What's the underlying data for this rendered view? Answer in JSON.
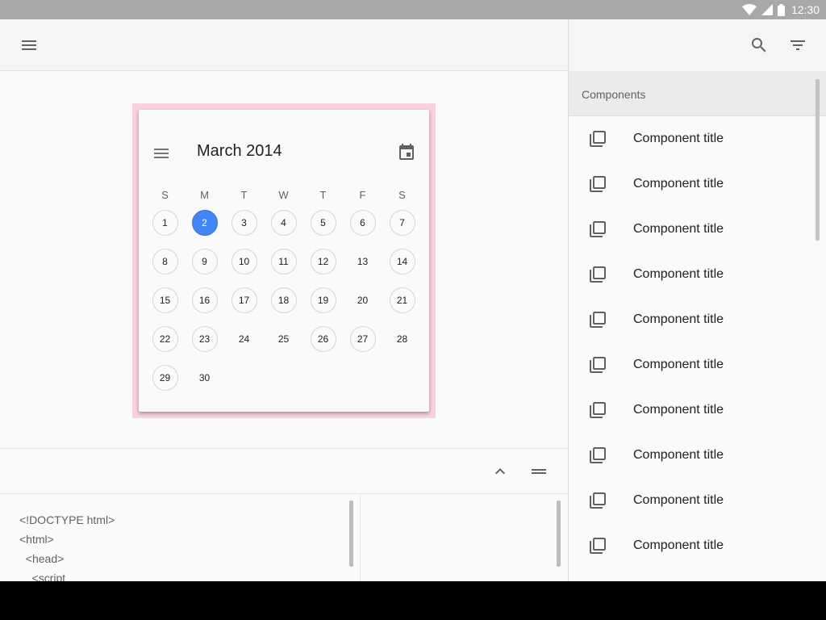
{
  "status_bar": {
    "time": "12:30"
  },
  "calendar": {
    "title": "March 2014",
    "weekdays": [
      "S",
      "M",
      "T",
      "W",
      "T",
      "F",
      "S"
    ],
    "selected_day": 2,
    "days": [
      {
        "label": "1",
        "ring": true
      },
      {
        "label": "2",
        "ring": true
      },
      {
        "label": "3",
        "ring": true
      },
      {
        "label": "4",
        "ring": true
      },
      {
        "label": "5",
        "ring": true
      },
      {
        "label": "6",
        "ring": true
      },
      {
        "label": "7",
        "ring": true
      },
      {
        "label": "8",
        "ring": true
      },
      {
        "label": "9",
        "ring": true
      },
      {
        "label": "10",
        "ring": true
      },
      {
        "label": "11",
        "ring": true
      },
      {
        "label": "12",
        "ring": true
      },
      {
        "label": "13",
        "ring": false
      },
      {
        "label": "14",
        "ring": true
      },
      {
        "label": "15",
        "ring": true
      },
      {
        "label": "16",
        "ring": true
      },
      {
        "label": "17",
        "ring": true
      },
      {
        "label": "18",
        "ring": true
      },
      {
        "label": "19",
        "ring": true
      },
      {
        "label": "20",
        "ring": false
      },
      {
        "label": "21",
        "ring": true
      },
      {
        "label": "22",
        "ring": true
      },
      {
        "label": "23",
        "ring": true
      },
      {
        "label": "24",
        "ring": false
      },
      {
        "label": "25",
        "ring": false
      },
      {
        "label": "26",
        "ring": true
      },
      {
        "label": "27",
        "ring": true
      },
      {
        "label": "28",
        "ring": false
      },
      {
        "label": "29",
        "ring": true
      },
      {
        "label": "30",
        "ring": false
      }
    ],
    "colors": {
      "selected": "#4285f4",
      "frame": "#f8d1dc"
    }
  },
  "code": {
    "lines": [
      "<!DOCTYPE html>",
      "<html>",
      "  <head>",
      "    <script"
    ]
  },
  "components": {
    "header": "Components",
    "items": [
      "Component title",
      "Component title",
      "Component title",
      "Component title",
      "Component title",
      "Component title",
      "Component title",
      "Component title",
      "Component title",
      "Component title"
    ]
  },
  "icons": {
    "status": [
      "wifi-icon",
      "cell-signal-icon",
      "battery-icon"
    ],
    "left_toolbar": "menu-icon",
    "calendar": [
      "menu-icon",
      "event-icon"
    ],
    "bottom_toolbar": [
      "chevron-up-icon",
      "drag-handle-icon"
    ],
    "right_toolbar": [
      "search-icon",
      "filter-icon"
    ],
    "component": "component-icon"
  }
}
